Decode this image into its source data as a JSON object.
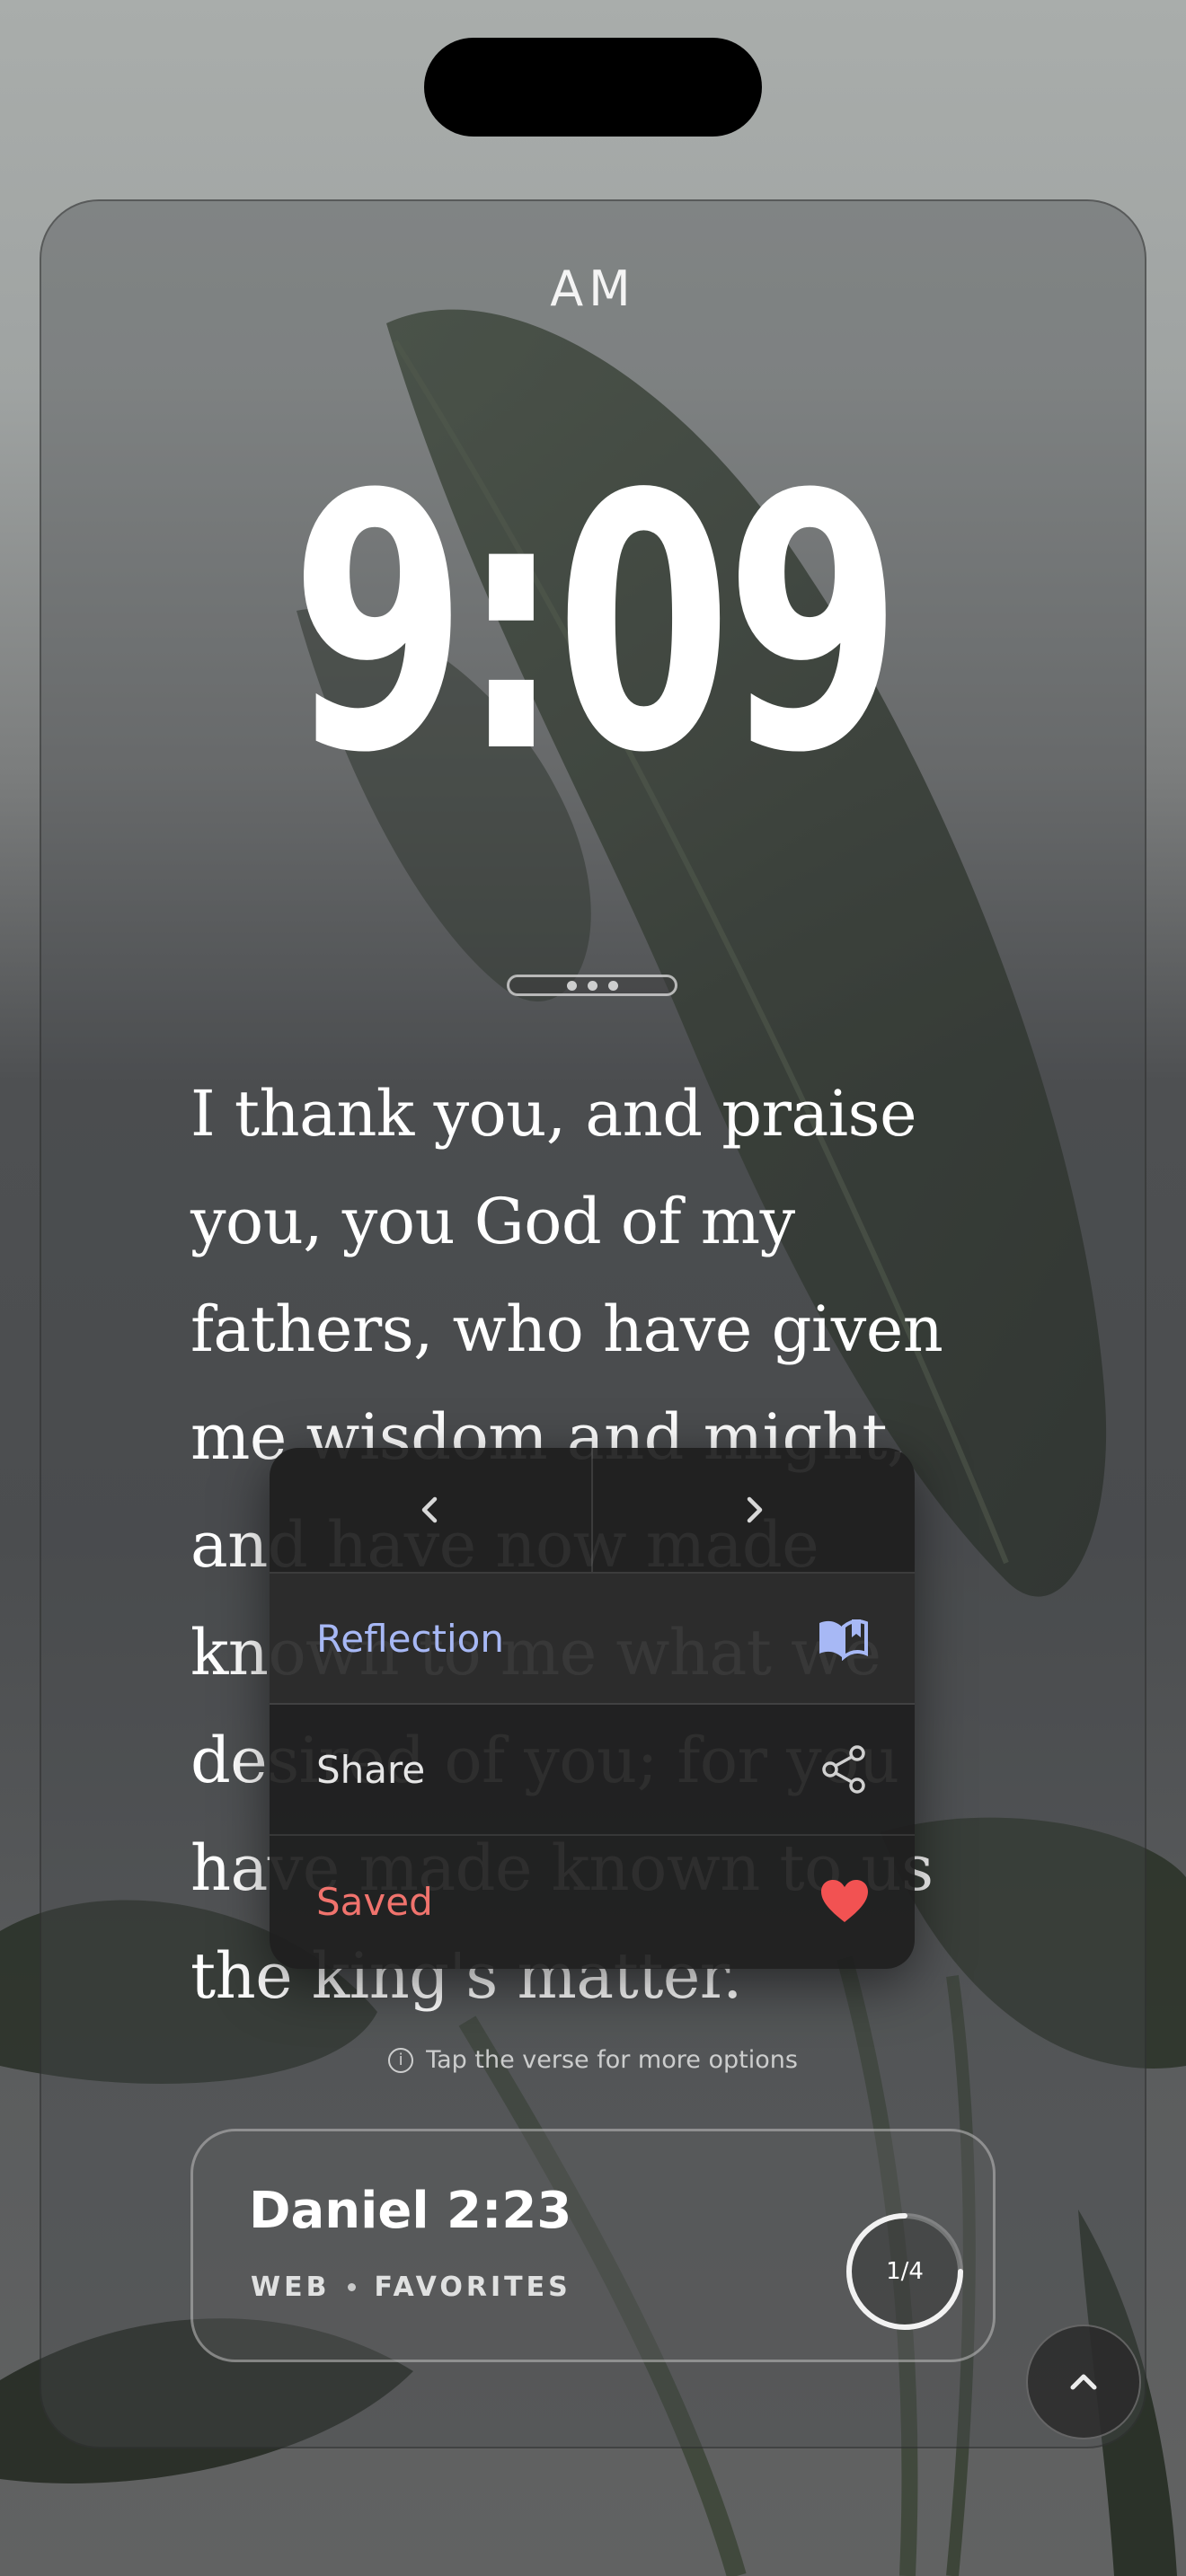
{
  "clock": {
    "period": "AM",
    "time": "9:09"
  },
  "verse": {
    "text": "I thank you, and praise you, you God of my fathers, who have given me wisdom and might, and have now made known to me what we desired of you; for you have made known to us the king's matter.",
    "reference": "Daniel 2:23",
    "translation": "WEB",
    "collection": "FAVORITES",
    "position": "1/4",
    "progress_fraction": 0.25
  },
  "menu": {
    "prev_icon": "chevron-left-icon",
    "next_icon": "chevron-right-icon",
    "items": [
      {
        "label": "Reflection",
        "icon": "book-open-icon",
        "color": "#a7b8f5"
      },
      {
        "label": "Share",
        "icon": "share-icon",
        "color": "#e6e6e6"
      },
      {
        "label": "Saved",
        "icon": "heart-icon",
        "color": "#f0736d"
      }
    ]
  },
  "hint": {
    "text": "Tap the verse for more options",
    "icon": "info-icon"
  },
  "colors": {
    "heart": "#f25252",
    "reflection_accent": "#a7b8f5"
  }
}
